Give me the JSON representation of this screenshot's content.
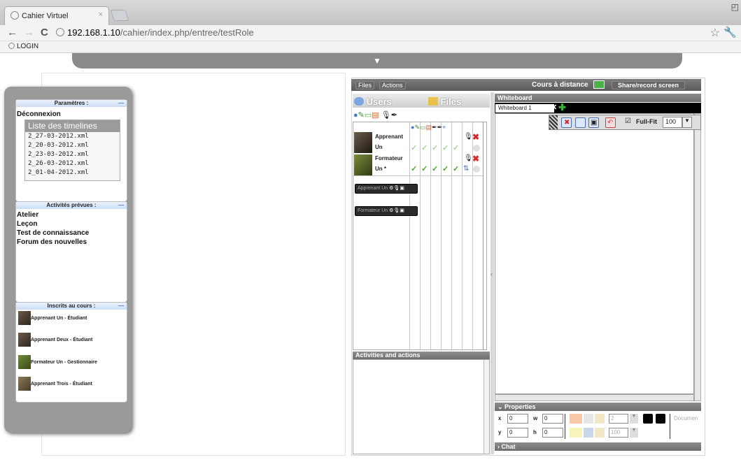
{
  "browser": {
    "tab_title": "Cahier Virtuel",
    "tab_close": "×",
    "url_host": "192.168.1.10",
    "url_path": "/cahier/index.php/entree/testRole",
    "bookmark": "LOGIN"
  },
  "sidebar": {
    "params_title": "Paramètres :",
    "logout": "Déconnexion",
    "timelines_title": "Liste des timelines",
    "timelines": [
      "2_27-03-2012.xml",
      "2_20-03-2012.xml",
      "2_23-03-2012.xml",
      "2_26-03-2012.xml",
      "2_01-04-2012.xml"
    ],
    "activities_title": "Activités prévues :",
    "activities": [
      "Atelier",
      "Leçon",
      "Test de connaissance",
      "Forum des nouvelles"
    ],
    "enrolled_title": "Inscrits au cours :",
    "enrolled": [
      "Apprenant Un - Étudiant",
      "Apprenant Deux - Étudiant",
      "Formateur Un - Gestionnaire",
      "Apprenant Trois - Étudiant"
    ],
    "minimize": "—"
  },
  "app": {
    "tab_files": "Files",
    "tab_actions": "Actions",
    "course_title": "Cours à distance",
    "share_button": "Share/record screen",
    "users_label": "Users",
    "files_label": "Files",
    "users": [
      {
        "first": "Apprenant",
        "last": "Un"
      },
      {
        "first": "Formateur",
        "last": "Un *"
      }
    ],
    "user_chips": [
      "Apprenant Un",
      "Formateur Un"
    ],
    "activities_header": "Activities and actions",
    "whiteboard_header": "Whiteboard",
    "whiteboard_tab": "Whiteboard 1",
    "fullfit": "Full-Fit",
    "zoom": "100",
    "properties_header": "Properties",
    "props": {
      "x": "0",
      "y": "0",
      "w": "0",
      "h": "0",
      "stroke": "2",
      "opacity": "100",
      "doc_label": "Documen"
    },
    "chat_header": "Chat"
  },
  "colors": {
    "accent": "#4a78c8",
    "check": "#4aa62a",
    "delete": "#d42a2a"
  }
}
